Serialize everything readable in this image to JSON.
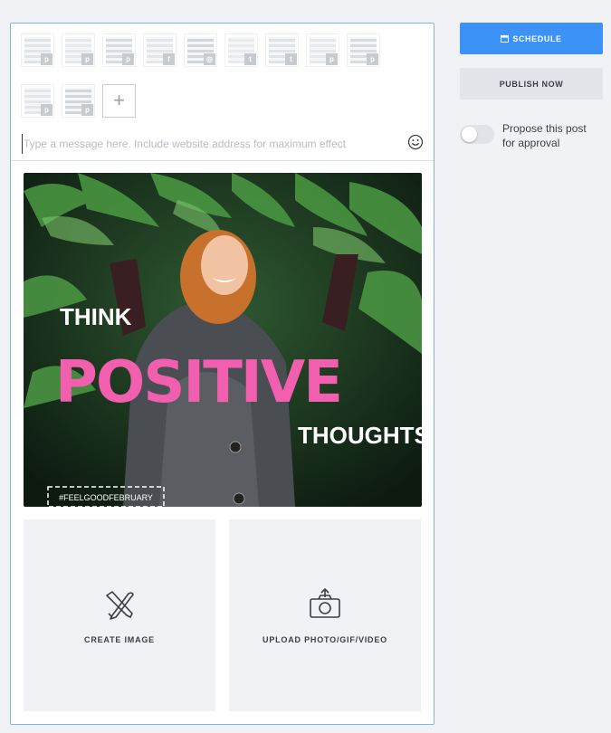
{
  "composer": {
    "message_placeholder": "Type a message here. Include website address for maximum effect",
    "profiles": [
      {
        "network": "pinterest",
        "icon": "pinterest-icon",
        "glyph": "p"
      },
      {
        "network": "pinterest",
        "icon": "pinterest-icon",
        "glyph": "p"
      },
      {
        "network": "pinterest",
        "icon": "pinterest-icon",
        "glyph": "p"
      },
      {
        "network": "facebook",
        "icon": "facebook-icon",
        "glyph": "f"
      },
      {
        "network": "instagram",
        "icon": "instagram-icon",
        "glyph": "◎"
      },
      {
        "network": "twitter",
        "icon": "twitter-icon",
        "glyph": "t"
      },
      {
        "network": "twitter",
        "icon": "twitter-icon",
        "glyph": "t"
      },
      {
        "network": "pinterest",
        "icon": "pinterest-icon",
        "glyph": "p"
      },
      {
        "network": "pinterest",
        "icon": "pinterest-icon",
        "glyph": "p"
      },
      {
        "network": "pinterest",
        "icon": "pinterest-icon",
        "glyph": "p"
      },
      {
        "network": "pinterest",
        "icon": "pinterest-icon",
        "glyph": "p"
      }
    ],
    "add_profile_symbol": "+",
    "image": {
      "headline_top": "THINK",
      "headline_main": "POSITIVE",
      "headline_bottom": "THOUGHTS",
      "hashtag": "#FEELGOODFEBRUARY",
      "accent_color": "#f15fae"
    },
    "tiles": {
      "create_label": "CREATE IMAGE",
      "upload_label": "UPLOAD PHOTO/GIF/VIDEO"
    }
  },
  "actions": {
    "schedule_label": "SCHEDULE",
    "publish_label": "PUBLISH NOW",
    "approval_label": "Propose this post for approval",
    "approval_enabled": false,
    "primary_color": "#3d92f7"
  }
}
